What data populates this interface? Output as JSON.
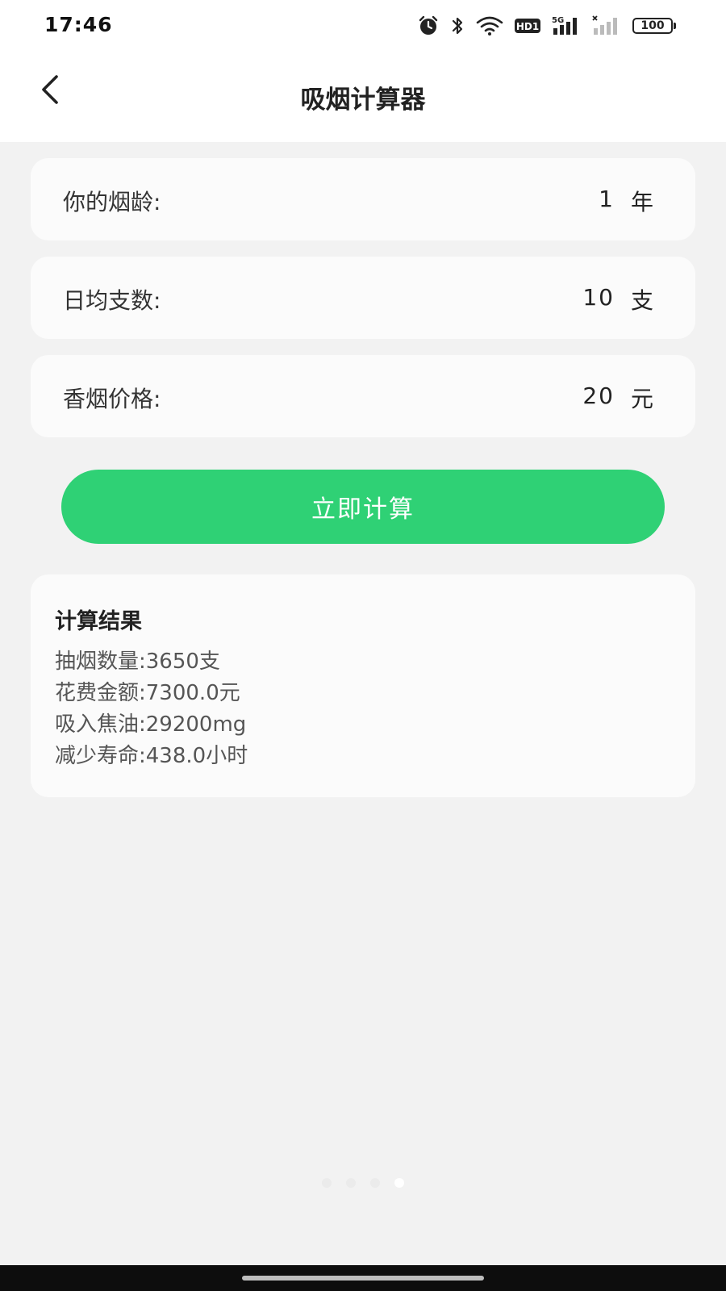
{
  "status_bar": {
    "time": "17:46",
    "battery": "100",
    "icons": [
      "alarm-icon",
      "bluetooth-icon",
      "wifi-icon",
      "hd-icon",
      "signal-5g-icon",
      "signal-weak-icon",
      "battery-icon"
    ],
    "hd_label": "HD1",
    "network_label": "5G"
  },
  "nav": {
    "title": "吸烟计算器",
    "back_icon": "chevron-left-icon"
  },
  "inputs": [
    {
      "label": "你的烟龄:",
      "value": "1",
      "unit": "年"
    },
    {
      "label": "日均支数:",
      "value": "10",
      "unit": "支"
    },
    {
      "label": "香烟价格:",
      "value": "20",
      "unit": "元"
    }
  ],
  "calculate": {
    "label": "立即计算",
    "color": "#2fd175"
  },
  "result": {
    "title": "计算结果",
    "lines": [
      "抽烟数量:3650支",
      "花费金额:7300.0元",
      "吸入焦油:29200mg",
      "减少寿命:438.0小时"
    ]
  },
  "pager": {
    "count": 4,
    "active_index": 3
  }
}
